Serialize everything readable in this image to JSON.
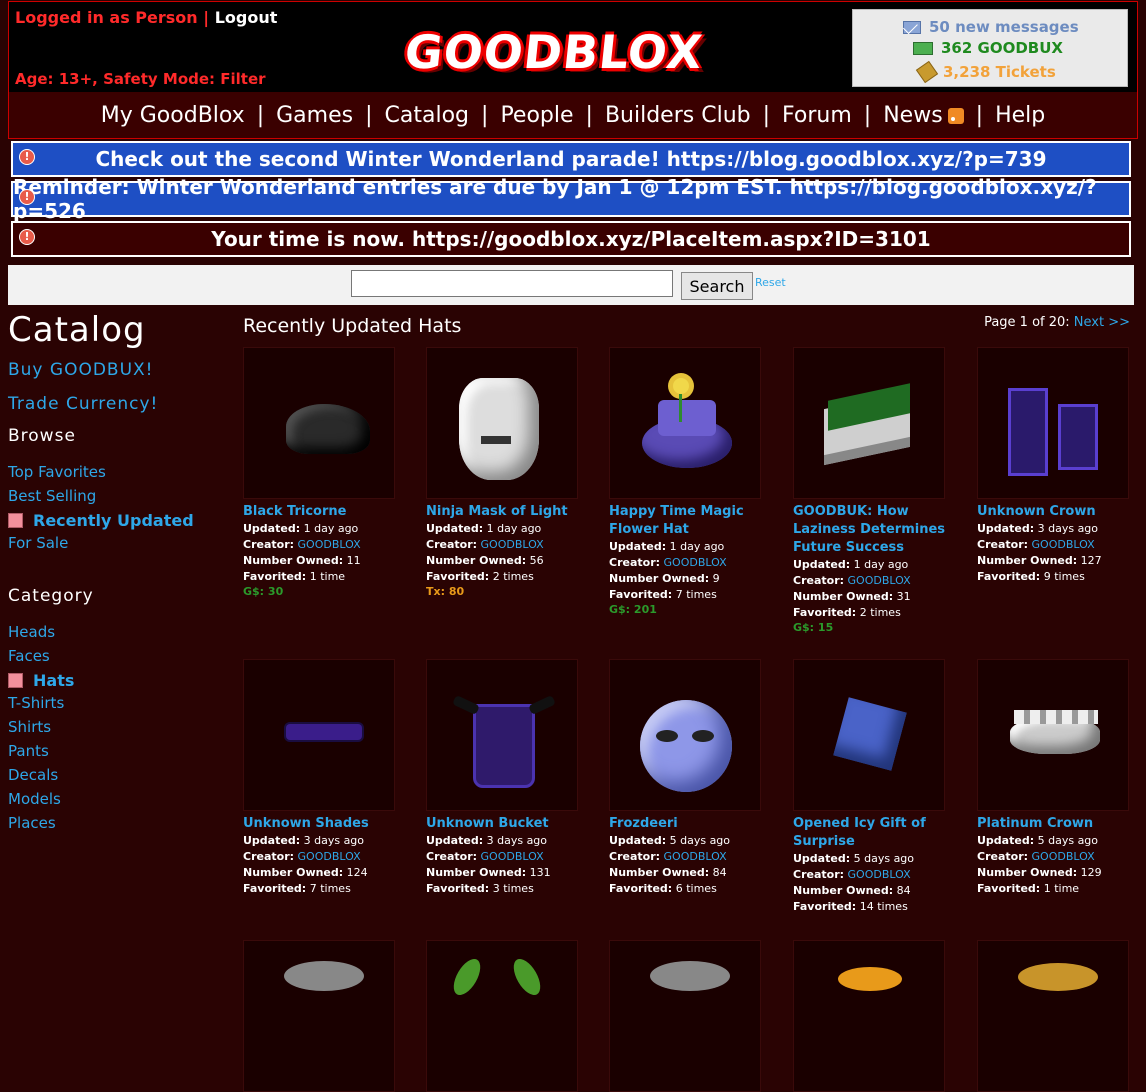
{
  "header": {
    "logged_in_text": "Logged in as Person",
    "divider": "|",
    "logout": "Logout",
    "age_line": "Age: 13+, Safety Mode: Filter",
    "logo_text": "GOODBLOX",
    "stats": {
      "messages": "50 new messages",
      "goodbux": "362 GOODBUX",
      "tickets": "3,238 Tickets"
    }
  },
  "nav": {
    "items": [
      "My GoodBlox",
      "Games",
      "Catalog",
      "People",
      "Builders Club",
      "Forum",
      "News",
      "Help"
    ],
    "separator": "|"
  },
  "alerts": [
    {
      "text": "Check out the second Winter Wonderland parade! https://blog.goodblox.xyz/?p=739",
      "color": "#1e4fc4"
    },
    {
      "text": "Reminder: Winter Wonderland entries are due by Jan 1 @ 12pm EST. https://blog.goodblox.xyz/?p=526",
      "color": "#1e4fc4"
    },
    {
      "text": "Your time is now. https://goodblox.xyz/PlaceItem.aspx?ID=3101",
      "color": "#3a0000"
    }
  ],
  "search": {
    "value": "",
    "button": "Search",
    "reset": "Reset"
  },
  "sidebar": {
    "title": "Catalog",
    "buy": "Buy GOODBUX!",
    "trade": "Trade Currency!",
    "browse_heading": "Browse",
    "browse": [
      "Top Favorites",
      "Best Selling",
      "Recently Updated",
      "For Sale"
    ],
    "browse_active": "Recently Updated",
    "category_heading": "Category",
    "categories": [
      "Heads",
      "Faces",
      "Hats",
      "T-Shirts",
      "Shirts",
      "Pants",
      "Decals",
      "Models",
      "Places"
    ],
    "category_active": "Hats"
  },
  "main": {
    "title": "Recently Updated Hats",
    "pager_prefix": "Page 1 of 20:",
    "pager_next": "Next >>"
  },
  "labels": {
    "updated": "Updated:",
    "creator": "Creator:",
    "owned": "Number Owned:",
    "favorited": "Favorited:"
  },
  "items": [
    {
      "name": "Black Tricorne",
      "updated": "1 day ago",
      "creator": "GOODBLOX",
      "owned": "11",
      "favorited": "1 time",
      "price": "G$: 30",
      "price_type": "g"
    },
    {
      "name": "Ninja Mask of Light",
      "updated": "1 day ago",
      "creator": "GOODBLOX",
      "owned": "56",
      "favorited": "2 times",
      "price": "Tx: 80",
      "price_type": "t"
    },
    {
      "name": "Happy Time Magic Flower Hat",
      "updated": "1 day ago",
      "creator": "GOODBLOX",
      "owned": "9",
      "favorited": "7 times",
      "price": "G$: 201",
      "price_type": "g"
    },
    {
      "name": "GOODBUK: How Laziness Determines Future Success",
      "updated": "1 day ago",
      "creator": "GOODBLOX",
      "owned": "31",
      "favorited": "2 times",
      "price": "G$: 15",
      "price_type": "g"
    },
    {
      "name": "Unknown Crown",
      "updated": "3 days ago",
      "creator": "GOODBLOX",
      "owned": "127",
      "favorited": "9 times",
      "price": "",
      "price_type": ""
    },
    {
      "name": "Unknown Shades",
      "updated": "3 days ago",
      "creator": "GOODBLOX",
      "owned": "124",
      "favorited": "7 times",
      "price": "",
      "price_type": ""
    },
    {
      "name": "Unknown Bucket",
      "updated": "3 days ago",
      "creator": "GOODBLOX",
      "owned": "131",
      "favorited": "3 times",
      "price": "",
      "price_type": ""
    },
    {
      "name": "Frozdeeri",
      "updated": "5 days ago",
      "creator": "GOODBLOX",
      "owned": "84",
      "favorited": "6 times",
      "price": "",
      "price_type": ""
    },
    {
      "name": "Opened Icy Gift of Surprise",
      "updated": "5 days ago",
      "creator": "GOODBLOX",
      "owned": "84",
      "favorited": "14 times",
      "price": "",
      "price_type": ""
    },
    {
      "name": "Platinum Crown",
      "updated": "5 days ago",
      "creator": "GOODBLOX",
      "owned": "129",
      "favorited": "1 time",
      "price": "",
      "price_type": ""
    }
  ],
  "colors": {
    "background": "#2a0303",
    "link": "#2ea7e8",
    "alert_blue": "#1e4fc4",
    "alert_dark": "#3a0000",
    "goodbux_green": "#1f8a1f",
    "tickets_orange": "#f2a23a"
  },
  "icons": {
    "messages": "mail-icon",
    "goodbux": "money-icon",
    "tickets": "ticket-icon",
    "news": "rss-icon",
    "alert": "warning-icon"
  }
}
